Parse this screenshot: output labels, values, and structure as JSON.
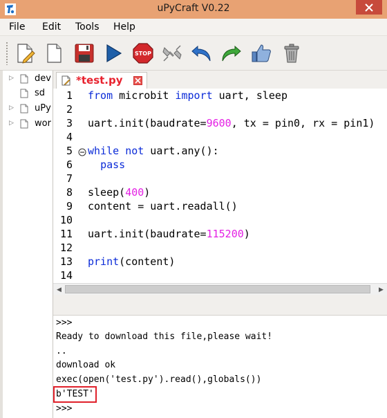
{
  "window": {
    "title": "uPyCraft V0.22"
  },
  "menu": [
    "File",
    "Edit",
    "Tools",
    "Help"
  ],
  "toolbar": {
    "buttons": [
      "new-file",
      "open-file",
      "save",
      "run",
      "stop",
      "connect",
      "undo",
      "redo",
      "syntax-check",
      "clear"
    ]
  },
  "filetree": {
    "items": [
      {
        "label": "dev",
        "expandable": true
      },
      {
        "label": "sd",
        "expandable": false
      },
      {
        "label": "uPy",
        "expandable": true
      },
      {
        "label": "wor",
        "expandable": true
      }
    ]
  },
  "tab": {
    "title": "*test.py"
  },
  "editor": {
    "lines": [
      {
        "n": "1",
        "parts": [
          {
            "t": "from",
            "c": "kw"
          },
          {
            "t": " microbit ",
            "c": ""
          },
          {
            "t": "import",
            "c": "kw"
          },
          {
            "t": " uart, sleep",
            "c": ""
          }
        ]
      },
      {
        "n": "2",
        "parts": []
      },
      {
        "n": "3",
        "parts": [
          {
            "t": "uart.init(baudrate=",
            "c": ""
          },
          {
            "t": "9600",
            "c": "num"
          },
          {
            "t": ", tx = pin0, rx = pin1)",
            "c": ""
          }
        ]
      },
      {
        "n": "4",
        "parts": []
      },
      {
        "n": "5",
        "parts": [
          {
            "t": "while",
            "c": "kw"
          },
          {
            "t": " ",
            "c": ""
          },
          {
            "t": "not",
            "c": "kw"
          },
          {
            "t": " uart.any():",
            "c": ""
          }
        ]
      },
      {
        "n": "6",
        "parts": [
          {
            "t": "  ",
            "c": ""
          },
          {
            "t": "pass",
            "c": "kw"
          }
        ]
      },
      {
        "n": "7",
        "parts": []
      },
      {
        "n": "8",
        "parts": [
          {
            "t": "sleep(",
            "c": ""
          },
          {
            "t": "400",
            "c": "num"
          },
          {
            "t": ")",
            "c": ""
          }
        ]
      },
      {
        "n": "9",
        "parts": [
          {
            "t": "content = uart.readall()",
            "c": ""
          }
        ]
      },
      {
        "n": "10",
        "parts": []
      },
      {
        "n": "11",
        "parts": [
          {
            "t": "uart.init(baudrate=",
            "c": ""
          },
          {
            "t": "115200",
            "c": "num"
          },
          {
            "t": ")",
            "c": ""
          }
        ]
      },
      {
        "n": "12",
        "parts": []
      },
      {
        "n": "13",
        "parts": [
          {
            "t": "print",
            "c": "kw"
          },
          {
            "t": "(content)",
            "c": ""
          }
        ]
      },
      {
        "n": "14",
        "parts": []
      }
    ]
  },
  "terminal": {
    "lines": [
      ">>>",
      "Ready to download this file,please wait!",
      "..",
      "download ok",
      "exec(open('test.py').read(),globals())",
      "b'TEST'",
      ">>>"
    ]
  },
  "colors": {
    "titlebar": "#e8a273",
    "keyword": "#0b2bd8",
    "number": "#e41fe4",
    "tab_title": "#e8222e",
    "highlight": "#e0202a"
  }
}
